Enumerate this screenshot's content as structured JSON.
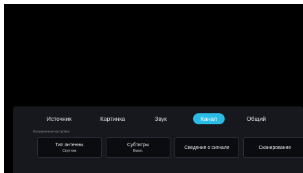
{
  "tabs": [
    {
      "label": "Источник",
      "active": false
    },
    {
      "label": "Картинка",
      "active": false
    },
    {
      "label": "Звук",
      "active": false
    },
    {
      "label": "Канал",
      "active": true
    },
    {
      "label": "Общий",
      "active": false
    }
  ],
  "section_label": "Расширенные настройки",
  "tiles": [
    {
      "title": "Тип антенны",
      "value": "Спутник"
    },
    {
      "title": "Субтитры",
      "value": "Выкл."
    },
    {
      "title": "Сведения о сигнале"
    },
    {
      "title": "Сканирование"
    }
  ],
  "colors": {
    "accent": "#2bbce6",
    "panel_bg": "#16181d",
    "screen_bg": "#000000"
  }
}
